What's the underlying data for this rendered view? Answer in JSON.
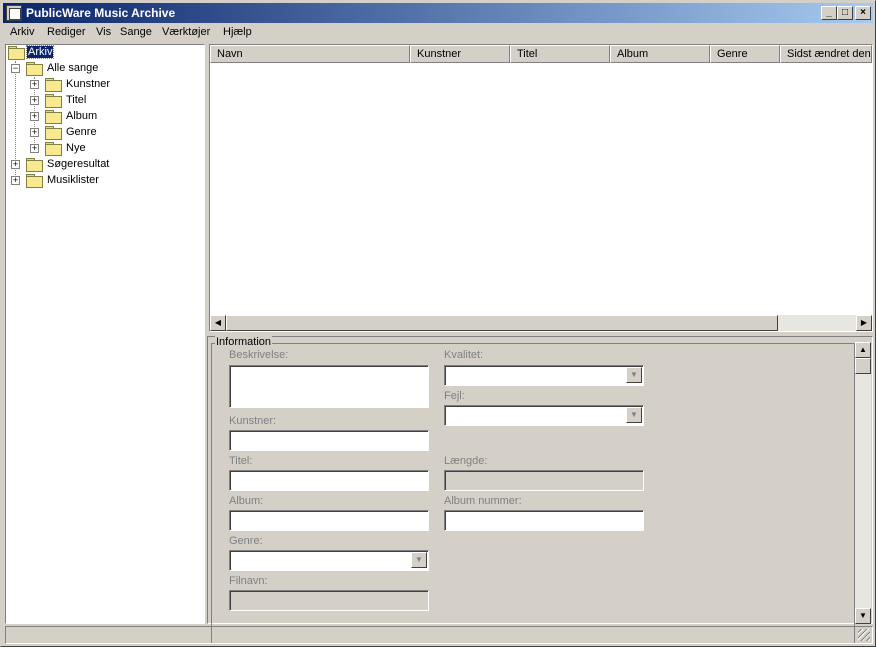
{
  "window": {
    "title": "PublicWare Music Archive"
  },
  "titlebar_buttons": {
    "minimize": "_",
    "maximize": "□",
    "close": "×"
  },
  "menu": [
    {
      "label": "Arkiv"
    },
    {
      "label": "Rediger"
    },
    {
      "label": "Vis"
    },
    {
      "label": "Sange"
    },
    {
      "label": "Værktøjer"
    },
    {
      "label": "Hjælp"
    }
  ],
  "tree": {
    "root": "Arkiv",
    "items": [
      {
        "label": "Alle sange",
        "expander": "−"
      },
      {
        "label": "Kunstner",
        "expander": "+"
      },
      {
        "label": "Titel",
        "expander": "+"
      },
      {
        "label": "Album",
        "expander": "+"
      },
      {
        "label": "Genre",
        "expander": "+"
      },
      {
        "label": "Nye",
        "expander": "+"
      },
      {
        "label": "Søgeresultat",
        "expander": "+"
      },
      {
        "label": "Musiklister",
        "expander": "+"
      }
    ]
  },
  "list": {
    "columns": [
      "Navn",
      "Kunstner",
      "Titel",
      "Album",
      "Genre",
      "Sidst ændret den"
    ]
  },
  "info": {
    "group_title": "Information",
    "labels": {
      "description": "Beskrivelse:",
      "artist": "Kunstner:",
      "title": "Titel:",
      "album": "Album:",
      "genre": "Genre:",
      "filename": "Filnavn:",
      "quality": "Kvalitet:",
      "error": "Fejl:",
      "length": "Længde:",
      "album_number": "Album nummer:"
    }
  },
  "icons": {
    "combo_arrow": "▼",
    "arrow_left": "◀",
    "arrow_right": "▶",
    "arrow_up": "▲",
    "arrow_down": "▼"
  }
}
